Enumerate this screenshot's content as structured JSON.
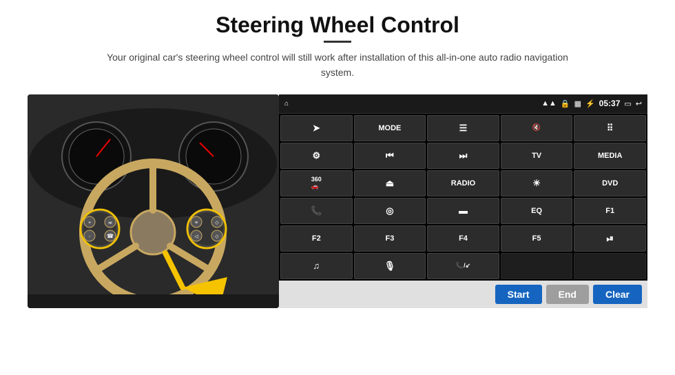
{
  "header": {
    "title": "Steering Wheel Control",
    "subtitle": "Your original car's steering wheel control will still work after installation of this all-in-one auto radio navigation system."
  },
  "statusBar": {
    "time": "05:37",
    "icons": [
      "home",
      "wifi",
      "lock",
      "sim",
      "bluetooth",
      "screen",
      "back"
    ]
  },
  "buttons": [
    {
      "row": 1,
      "col": 1,
      "label": "",
      "icon": "➤",
      "type": "nav"
    },
    {
      "row": 1,
      "col": 2,
      "label": "MODE",
      "icon": "",
      "type": "text"
    },
    {
      "row": 1,
      "col": 3,
      "label": "",
      "icon": "≡",
      "type": "icon"
    },
    {
      "row": 1,
      "col": 4,
      "label": "",
      "icon": "🔇",
      "type": "icon"
    },
    {
      "row": 1,
      "col": 5,
      "label": "",
      "icon": "⠿",
      "type": "icon"
    },
    {
      "row": 2,
      "col": 1,
      "label": "",
      "icon": "⚙",
      "type": "icon"
    },
    {
      "row": 2,
      "col": 2,
      "label": "",
      "icon": "⏮",
      "type": "icon"
    },
    {
      "row": 2,
      "col": 3,
      "label": "",
      "icon": "⏭",
      "type": "icon"
    },
    {
      "row": 2,
      "col": 4,
      "label": "TV",
      "icon": "",
      "type": "text"
    },
    {
      "row": 2,
      "col": 5,
      "label": "MEDIA",
      "icon": "",
      "type": "text"
    },
    {
      "row": 3,
      "col": 1,
      "label": "360",
      "icon": "",
      "type": "text-small"
    },
    {
      "row": 3,
      "col": 2,
      "label": "",
      "icon": "▲",
      "type": "icon"
    },
    {
      "row": 3,
      "col": 3,
      "label": "RADIO",
      "icon": "",
      "type": "text"
    },
    {
      "row": 3,
      "col": 4,
      "label": "",
      "icon": "☀",
      "type": "icon"
    },
    {
      "row": 3,
      "col": 5,
      "label": "DVD",
      "icon": "",
      "type": "text"
    },
    {
      "row": 4,
      "col": 1,
      "label": "",
      "icon": "📞",
      "type": "icon"
    },
    {
      "row": 4,
      "col": 2,
      "label": "",
      "icon": "◎",
      "type": "icon"
    },
    {
      "row": 4,
      "col": 3,
      "label": "",
      "icon": "▬",
      "type": "icon"
    },
    {
      "row": 4,
      "col": 4,
      "label": "EQ",
      "icon": "",
      "type": "text"
    },
    {
      "row": 4,
      "col": 5,
      "label": "F1",
      "icon": "",
      "type": "text"
    },
    {
      "row": 5,
      "col": 1,
      "label": "F2",
      "icon": "",
      "type": "text"
    },
    {
      "row": 5,
      "col": 2,
      "label": "F3",
      "icon": "",
      "type": "text"
    },
    {
      "row": 5,
      "col": 3,
      "label": "F4",
      "icon": "",
      "type": "text"
    },
    {
      "row": 5,
      "col": 4,
      "label": "F5",
      "icon": "",
      "type": "text"
    },
    {
      "row": 5,
      "col": 5,
      "label": "",
      "icon": "⏯",
      "type": "icon"
    },
    {
      "row": 6,
      "col": 1,
      "label": "",
      "icon": "♫",
      "type": "icon"
    },
    {
      "row": 6,
      "col": 2,
      "label": "",
      "icon": "🎤",
      "type": "icon"
    },
    {
      "row": 6,
      "col": 3,
      "label": "",
      "icon": "📞/↙",
      "type": "icon"
    },
    {
      "row": 6,
      "col": 4,
      "label": "",
      "icon": "",
      "type": "empty"
    },
    {
      "row": 6,
      "col": 5,
      "label": "",
      "icon": "",
      "type": "empty"
    }
  ],
  "bottomBar": {
    "startLabel": "Start",
    "endLabel": "End",
    "clearLabel": "Clear"
  }
}
